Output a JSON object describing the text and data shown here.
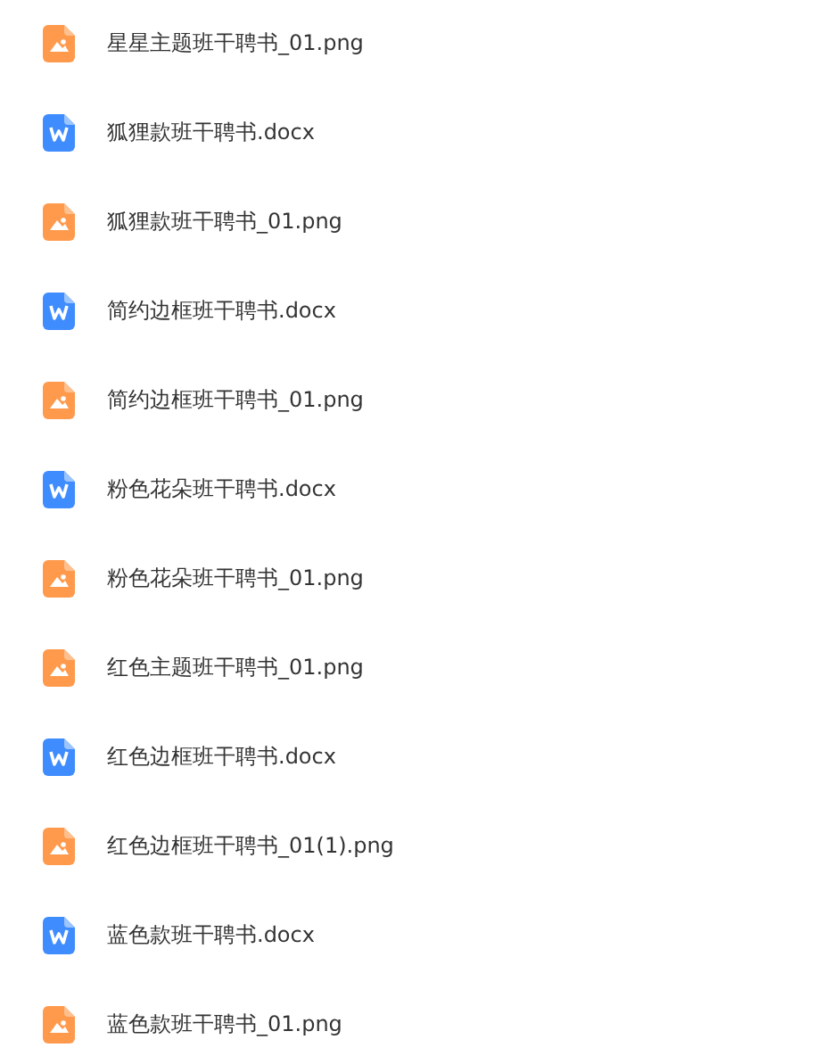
{
  "files": [
    {
      "kind": "image",
      "name": "星星主题班干聘书_01.png"
    },
    {
      "kind": "word",
      "name": "狐狸款班干聘书.docx"
    },
    {
      "kind": "image",
      "name": "狐狸款班干聘书_01.png"
    },
    {
      "kind": "word",
      "name": "简约边框班干聘书.docx"
    },
    {
      "kind": "image",
      "name": "简约边框班干聘书_01.png"
    },
    {
      "kind": "word",
      "name": "粉色花朵班干聘书.docx"
    },
    {
      "kind": "image",
      "name": "粉色花朵班干聘书_01.png"
    },
    {
      "kind": "image",
      "name": "红色主题班干聘书_01.png"
    },
    {
      "kind": "word",
      "name": "红色边框班干聘书.docx"
    },
    {
      "kind": "image",
      "name": "红色边框班干聘书_01(1).png"
    },
    {
      "kind": "word",
      "name": "蓝色款班干聘书.docx"
    },
    {
      "kind": "image",
      "name": "蓝色款班干聘书_01.png"
    }
  ]
}
